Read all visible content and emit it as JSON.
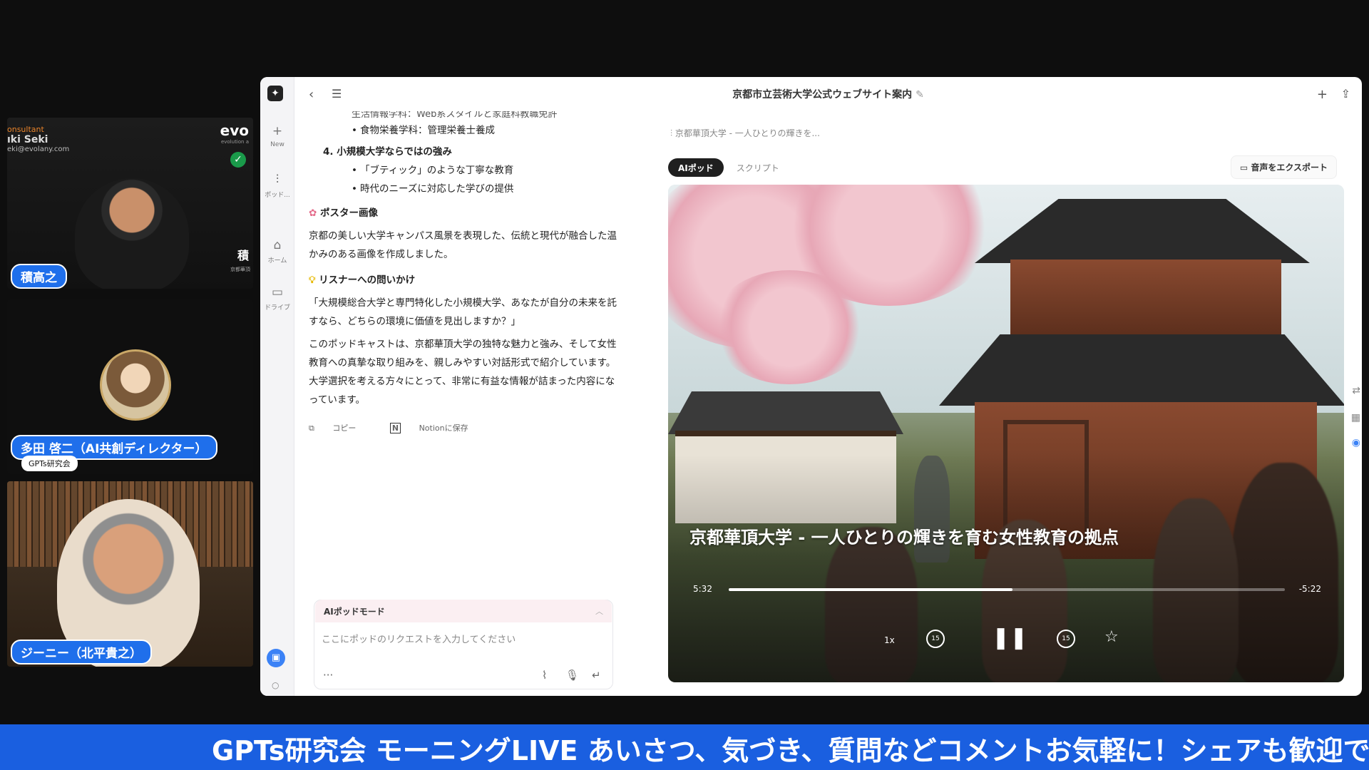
{
  "participants": {
    "p1": {
      "name": "積高之",
      "role_text": "onsultant",
      "name_text": "ıki Seki",
      "email_text": "eki@evolany.com",
      "brand": "evo",
      "brand_sub": "evolution a",
      "side_kanji": "積",
      "side_sub": "京都華頂"
    },
    "p2": {
      "name": "多田 啓二（AI共創ディレクター）",
      "sub_label": "GPTs研究会"
    },
    "p3": {
      "name": "ジーニー（北平貴之）"
    }
  },
  "app": {
    "title": "京都市立芸術大学公式ウェブサイト案内",
    "rail": {
      "new_label": "New",
      "pod_label": "ポッド...",
      "home_label": "ホーム",
      "drive_label": "ドライブ"
    },
    "chat": {
      "cut_line": "生活情報学科：Web系スタイルと家庭科教職免許",
      "bullets_a": [
        "食物栄養学科：管理栄養士養成"
      ],
      "heading4": "4. 小規模大学ならではの強み",
      "bullets_b": [
        "「ブティック」のような丁寧な教育",
        "時代のニーズに対応した学びの提供"
      ],
      "poster_heading": "ポスター画像",
      "poster_text": "京都の美しい大学キャンパス風景を表現した、伝統と現代が融合した温かみのある画像を作成しました。",
      "question_heading": "リスナーへの問いかけ",
      "question_text": "「大規模総合大学と専門特化した小規模大学、あなたが自分の未来を託すなら、どちらの環境に価値を見出しますか？」",
      "summary_text": "このポッドキャストは、京都華頂大学の独特な魅力と強み、そして女性教育への真摯な取り組みを、親しみやすい対話形式で紹介しています。大学選択を考える方々にとって、非常に有益な情報が詰まった内容になっています。",
      "copy_label": "コピー",
      "notion_label": "Notionに保存"
    },
    "input": {
      "mode_label": "AIポッドモード",
      "placeholder": "ここにポッドのリクエストを入力してください",
      "more": "···"
    },
    "player": {
      "breadcrumb": "京都華頂大学 - 一人ひとりの輝きを...",
      "tab_pod": "AIポッド",
      "tab_script": "スクリプト",
      "export_label": "音声をエクスポート",
      "episode_title": "京都華頂大学 - 一人ひとりの輝きを育む女性教育の拠点",
      "elapsed": "5:32",
      "remaining": "-5:22",
      "progress": 0.51,
      "speed": "1x",
      "skip_back": "15",
      "skip_fwd": "15"
    }
  },
  "ticker": "GPTs研究会 モーニングLIVE あいさつ、気づき、質問などコメントお気軽に！シェアも歓迎で"
}
